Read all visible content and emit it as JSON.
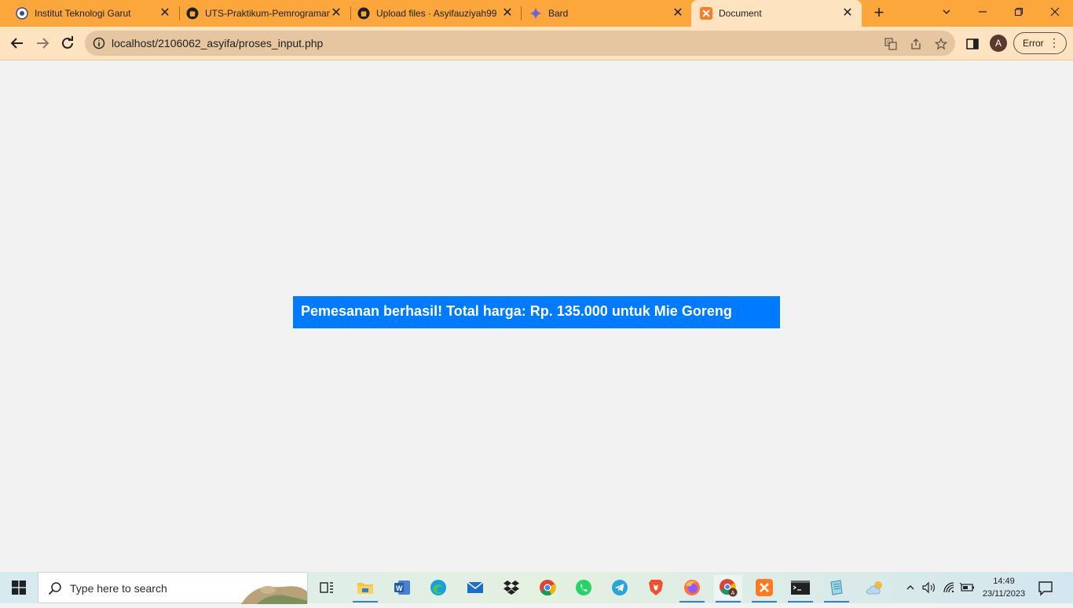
{
  "browser": {
    "tabs": [
      {
        "label": "Institut Teknologi Garut",
        "icon": "itg-logo-icon"
      },
      {
        "label": "UTS-Praktikum-Pemrograman",
        "icon": "github-icon"
      },
      {
        "label": "Upload files · Asyifauziyah99",
        "icon": "github-icon"
      },
      {
        "label": "Bard",
        "icon": "bard-sparkle-icon"
      },
      {
        "label": "Document",
        "icon": "xampp-icon",
        "active": true
      }
    ],
    "close_glyph": "✕",
    "new_tab_glyph": "+",
    "url": "localhost/2106062_asyifa/proses_input.php",
    "profile_initial": "A",
    "error_label": "Error",
    "menu_glyph": "⋮"
  },
  "page": {
    "message": "Pemesanan berhasil! Total harga: Rp. 135.000 untuk Mie Goreng",
    "message_bg": "#007bff"
  },
  "taskbar": {
    "search_placeholder": "Type here to search",
    "time": "14:49",
    "date": "23/11/2023"
  },
  "colors": {
    "tabstrip": "#fca73b",
    "toolbar": "#fde3bf",
    "accent": "#007bff"
  }
}
